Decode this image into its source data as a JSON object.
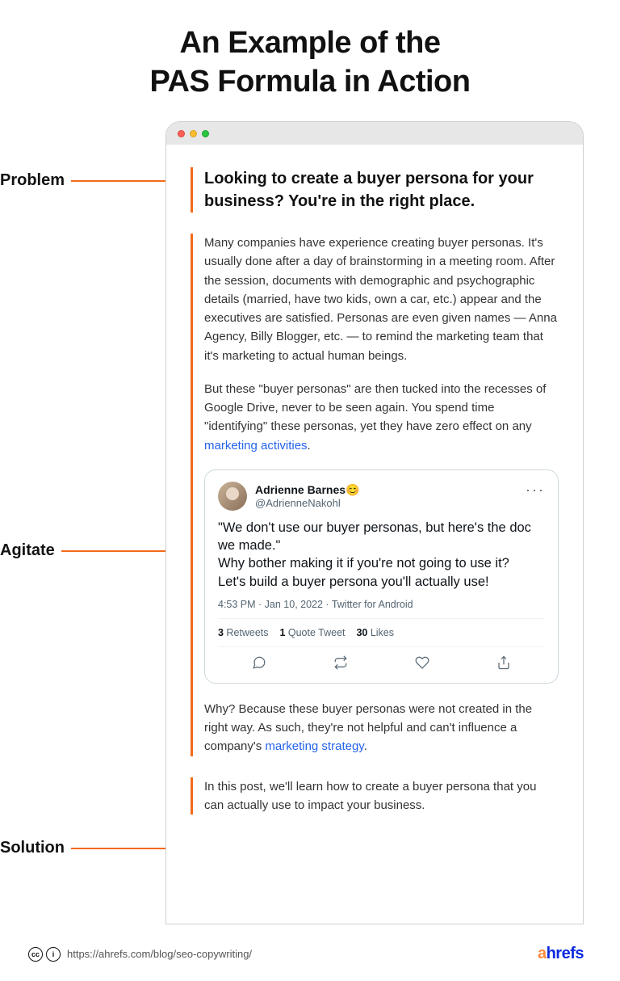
{
  "title_line1": "An Example of the",
  "title_line2": "PAS Formula in Action",
  "labels": {
    "problem": "Problem",
    "agitate": "Agitate",
    "solution": "Solution"
  },
  "problem": {
    "text": "Looking to create a buyer persona for your business? You're in the right place."
  },
  "agitate": {
    "para1": "Many companies have experience creating buyer personas. It's usually done after a day of brainstorming in a meeting room. After the session, documents with demographic and psychographic details (married, have two kids, own a car, etc.) appear and the executives are satisfied. Personas are even given names — Anna Agency, Billy Blogger, etc. — to remind the marketing team that it's marketing to actual human beings.",
    "para2_a": "But these \"buyer personas\" are then tucked into the recesses of Google Drive, never to be seen again. You spend time \"identifying\" these personas, yet they have zero effect on any ",
    "para2_link": "marketing activities",
    "para2_b": ".",
    "para3_a": "Why? Because these buyer personas were not created in the right way. As such, they're not helpful and can't influence a company's ",
    "para3_link": "marketing strategy",
    "para3_b": "."
  },
  "tweet": {
    "name": "Adrienne Barnes😊",
    "handle": "@AdrienneNakohl",
    "line1": "\"We don't use our buyer personas, but here's the doc we made.\"",
    "line2": "Why bother making it if you're not going to use it?",
    "line3": "Let's build a buyer persona you'll actually use!",
    "meta": "4:53 PM · Jan 10, 2022 · Twitter for Android",
    "retweets_n": "3",
    "retweets_l": " Retweets",
    "quotes_n": "1",
    "quotes_l": " Quote Tweet",
    "likes_n": "30",
    "likes_l": " Likes"
  },
  "solution": {
    "text": "In this post, we'll learn how to create a buyer persona that you can actually use to impact your business."
  },
  "footer": {
    "url": "https://ahrefs.com/blog/seo-copywriting/",
    "cc1": "cc",
    "cc2": "i",
    "logo_a": "a",
    "logo_b": "hrefs"
  }
}
